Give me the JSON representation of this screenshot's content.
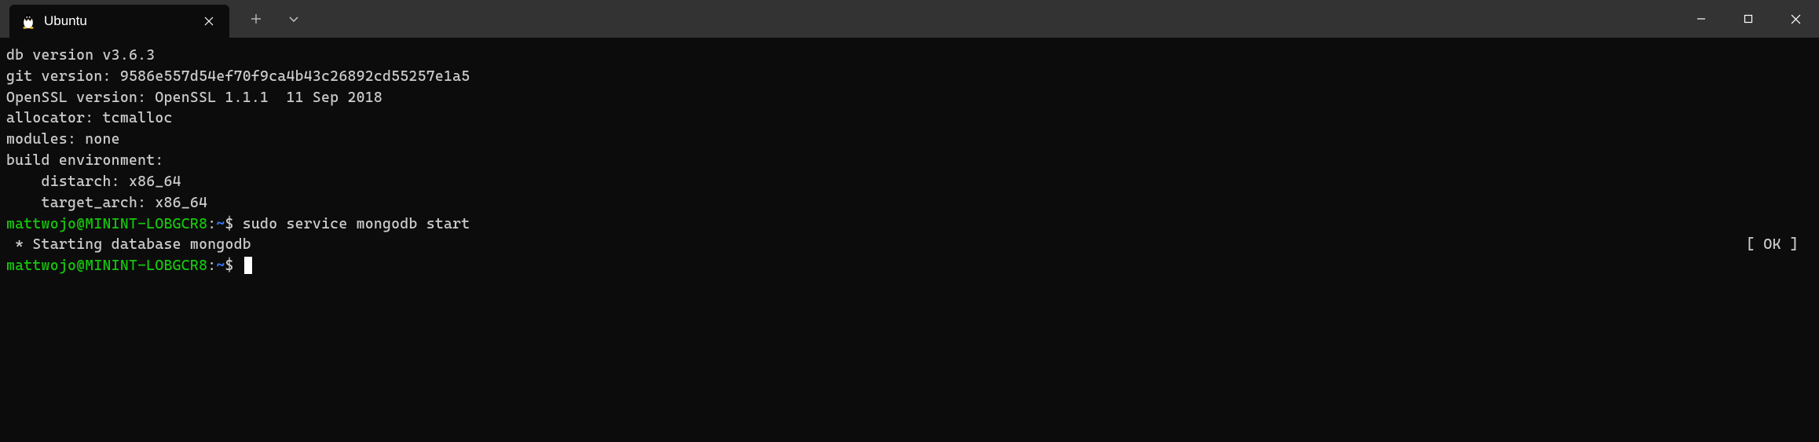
{
  "tab": {
    "title": "Ubuntu",
    "icon": "linux-penguin"
  },
  "terminal": {
    "output_lines": [
      "db version v3.6.3",
      "git version: 9586e557d54ef70f9ca4b43c26892cd55257e1a5",
      "OpenSSL version: OpenSSL 1.1.1  11 Sep 2018",
      "allocator: tcmalloc",
      "modules: none",
      "build environment:",
      "    distarch: x86_64",
      "    target_arch: x86_64"
    ],
    "prompt": {
      "user_host": "mattwojo@MININT-LOBGCR8",
      "path": "~",
      "symbol": "$"
    },
    "command1": "sudo service mongodb start",
    "status_line": {
      "left": " * Starting database mongodb",
      "right": "[ OK ]"
    },
    "command2": ""
  }
}
